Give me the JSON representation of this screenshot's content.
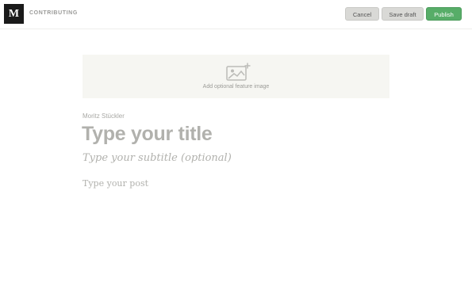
{
  "header": {
    "logo_letter": "M",
    "section": "CONTRIBUTING",
    "cancel_label": "Cancel",
    "save_draft_label": "Save draft",
    "publish_label": "Publish"
  },
  "editor": {
    "feature_image_label": "Add optional feature image",
    "feature_image_icon": "image-add-icon",
    "author": "Moritz Stückler",
    "title_placeholder": "Type your title",
    "subtitle_placeholder": "Type your subtitle (optional)",
    "post_placeholder": "Type your post"
  },
  "colors": {
    "publish": "#57ad68",
    "secondary_button": "#d9d9d6",
    "logo_bg": "#1a1a1a"
  }
}
